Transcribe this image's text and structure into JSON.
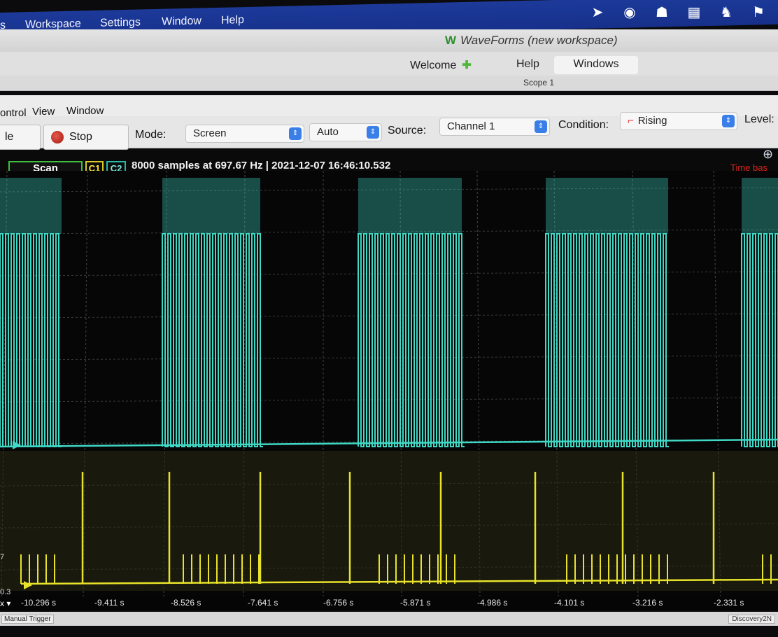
{
  "menubar": {
    "items": [
      "s",
      "Workspace",
      "Settings",
      "Window",
      "Help"
    ],
    "status_icons": [
      "location-arrow-icon",
      "circle-swirl-icon",
      "bell-icon",
      "grid-icon",
      "elephant-icon",
      "flag-icon"
    ]
  },
  "window": {
    "title": "WaveForms (new workspace)",
    "logo": "W"
  },
  "tabs": {
    "welcome": "Welcome",
    "help": "Help",
    "windows": "Windows"
  },
  "scope_label": "Scope 1",
  "menu": {
    "control": "ontrol",
    "view": "View",
    "window": "Window"
  },
  "toolbar": {
    "single_label": "le",
    "stop_label": "Stop",
    "mode_label": "Mode:",
    "mode_value": "Screen",
    "auto_value": "Auto",
    "source_label": "Source:",
    "source_value": "Channel 1",
    "condition_label": "Condition:",
    "condition_value": "Rising",
    "level_label": "Level:"
  },
  "acquisition": {
    "scan_label": "Scan",
    "c1_label": "C1",
    "c2_label": "C2",
    "info": "8000 samples at 697.67 Hz | 2021-12-07 16:46:10.532",
    "timebase_tag": "Time bas"
  },
  "colors": {
    "channel1": "#e8e32a",
    "channel2": "#3fd8c4",
    "grid": "#3a3a3a"
  },
  "axis": {
    "x_ticks": [
      "-10.296 s",
      "-9.411 s",
      "-8.526 s",
      "-7.641 s",
      "-6.756 s",
      "-5.871 s",
      "-4.986 s",
      "-4.101 s",
      "-3.216 s",
      "-2.331 s"
    ],
    "y_left_upper": "7",
    "y_left_lower": "0.3"
  },
  "status": {
    "manual_trigger": "Manual Trigger",
    "device": "Discovery2N"
  }
}
